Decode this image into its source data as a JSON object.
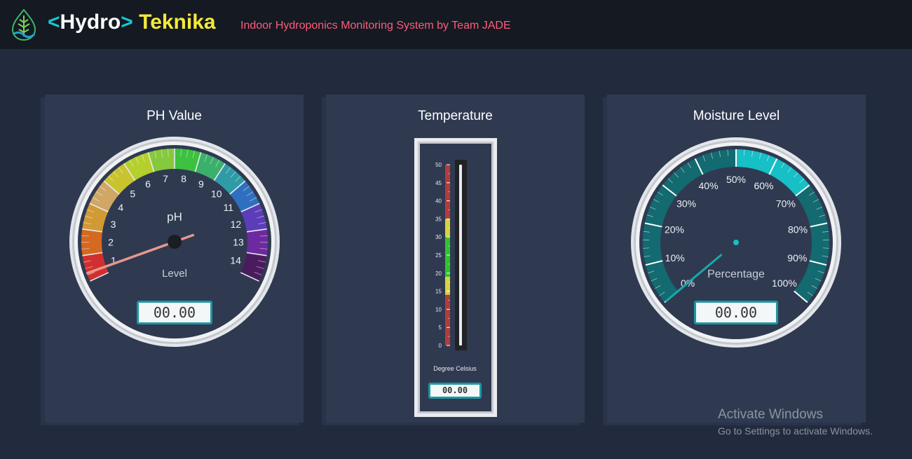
{
  "header": {
    "brand_open": "<",
    "brand_word1": "Hydro",
    "brand_close": ">",
    "brand_word2": "Teknika",
    "subtitle": "Indoor Hydroponics Monitoring System by Team JADE",
    "logo_icon": "leaf-drop-logo-icon"
  },
  "ph": {
    "title": "PH Value",
    "unit_label": "pH",
    "sub_label": "Level",
    "value": "00.00",
    "min": 1,
    "max": 14,
    "needle_value": 1,
    "ticks": [
      "1",
      "2",
      "3",
      "4",
      "5",
      "6",
      "7",
      "8",
      "9",
      "10",
      "11",
      "12",
      "13",
      "14"
    ],
    "colors": [
      "#d12f2f",
      "#d5691f",
      "#d19a35",
      "#d1a766",
      "#c9c32e",
      "#b5cf2d",
      "#86c93d",
      "#3dc13e",
      "#3bb06d",
      "#2e9ba6",
      "#2f6fbf",
      "#5b3db8",
      "#6d2aa0",
      "#4a1c5e"
    ]
  },
  "temperature": {
    "title": "Temperature",
    "unit_label": "Degree Celsius",
    "value": "00.00",
    "ticks": [
      "0",
      "5",
      "10",
      "15",
      "20",
      "25",
      "30",
      "35",
      "40",
      "45",
      "50"
    ],
    "level": 0
  },
  "moisture": {
    "title": "Moisture Level",
    "unit_label": "Percentage",
    "value": "00.00",
    "needle_value": 0,
    "ticks": [
      "0%",
      "10%",
      "20%",
      "30%",
      "40%",
      "50%",
      "60%",
      "70%",
      "80%",
      "90%",
      "100%"
    ]
  },
  "watermark": {
    "line1": "Activate Windows",
    "line2": "Go to Settings to activate Windows."
  }
}
